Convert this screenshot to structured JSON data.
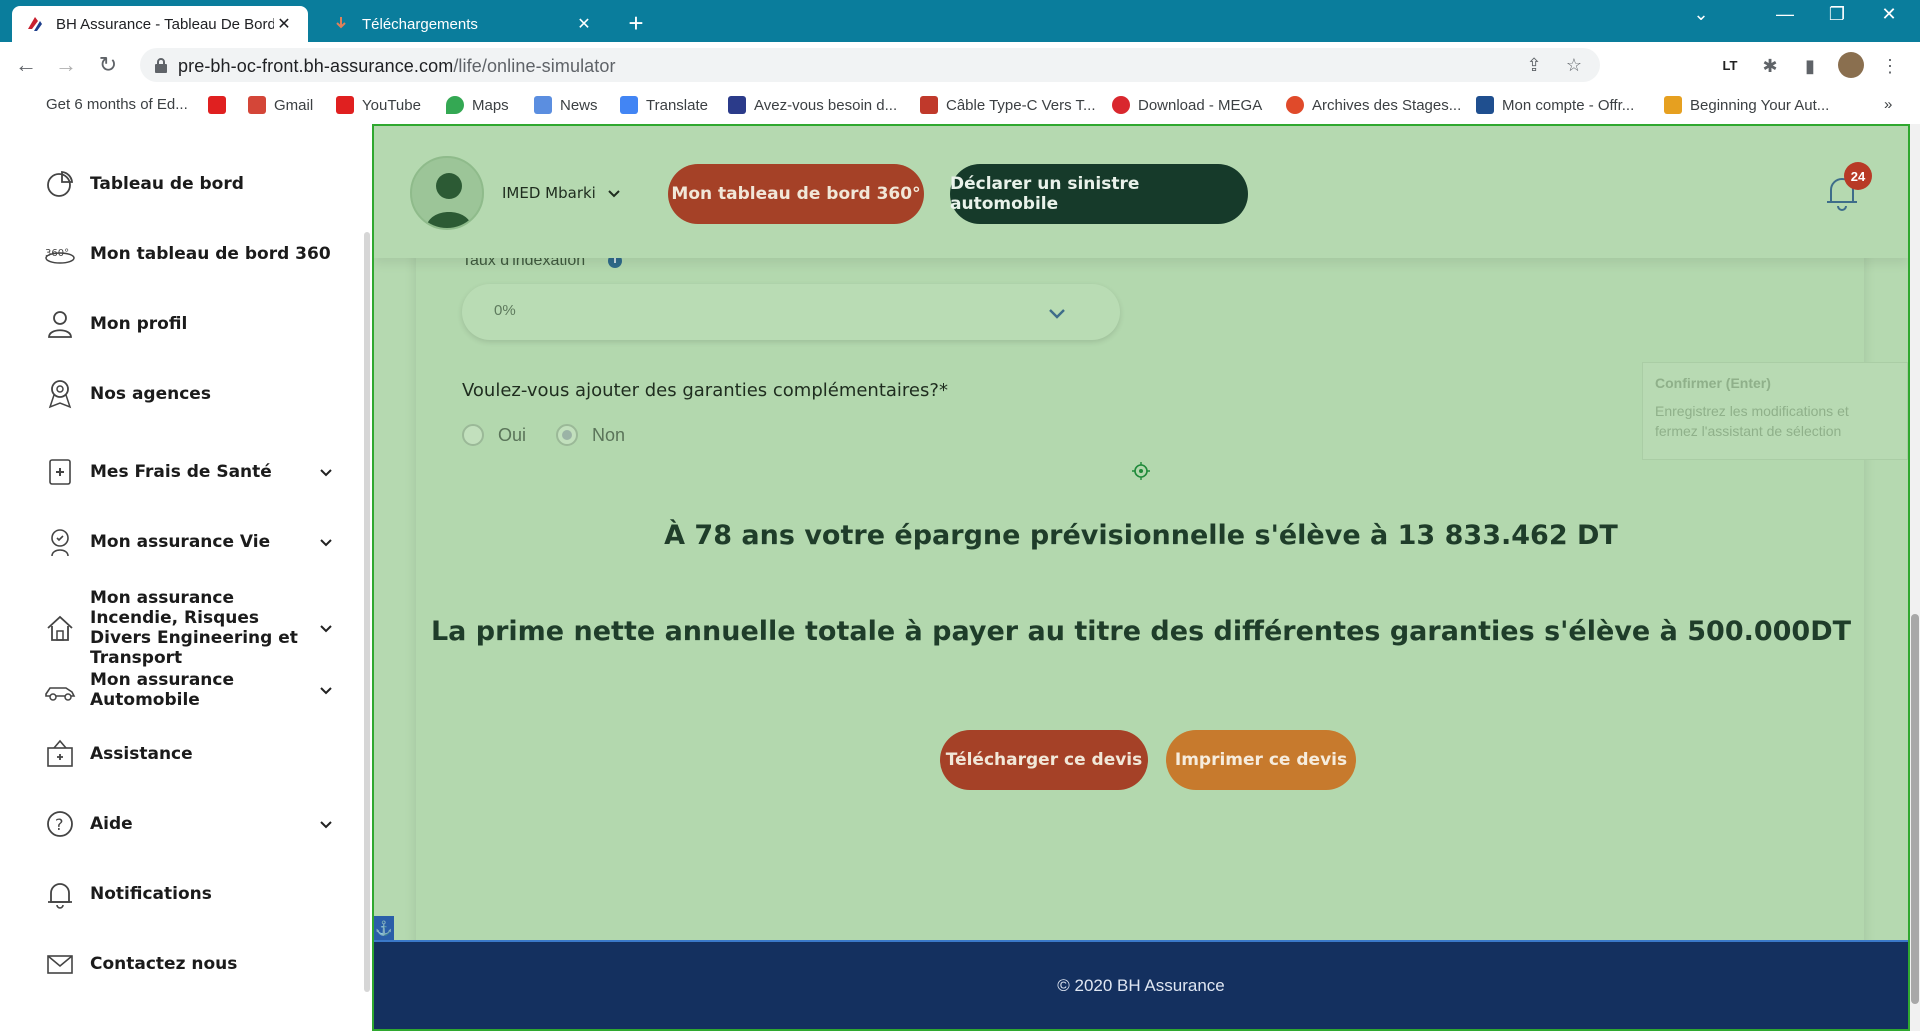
{
  "browser": {
    "tabs": [
      {
        "label": "BH Assurance - Tableau De Bord",
        "active": true,
        "close": "✕"
      },
      {
        "label": "Téléchargements",
        "active": false,
        "close": "✕"
      }
    ],
    "new_tab": "+",
    "window_controls": [
      "⌄",
      "—",
      "❐",
      "✕"
    ],
    "url_host": "pre-bh-oc-front.bh-assurance.com",
    "url_path": "/life/online-simulator",
    "bookmarks": [
      "Get 6 months of Ed...",
      "",
      "Gmail",
      "YouTube",
      "Maps",
      "News",
      "Translate",
      "Avez-vous besoin d...",
      "Câble Type-C Vers T...",
      "Download - MEGA",
      "Archives des Stages...",
      "Mon compte - Offr...",
      "Beginning Your Aut..."
    ],
    "bookmarks_more": "»",
    "extension_lt": "LT"
  },
  "sidebar": {
    "items": [
      {
        "label": "Tableau de bord",
        "icon": "chart-pie-icon",
        "chevron": false
      },
      {
        "label": "Mon tableau de bord 360",
        "icon": "360-icon",
        "chevron": false
      },
      {
        "label": "Mon profil",
        "icon": "user-icon",
        "chevron": false
      },
      {
        "label": "Nos agences",
        "icon": "map-pin-icon",
        "chevron": false
      },
      {
        "label": "Mes Frais de Santé",
        "icon": "health-icon",
        "chevron": true
      },
      {
        "label": "Mon assurance Vie",
        "icon": "life-icon",
        "chevron": true
      },
      {
        "label": "Mon assurance Incendie, Risques Divers Engineering et Transport",
        "icon": "house-icon",
        "chevron": true
      },
      {
        "label": "Mon assurance Automobile",
        "icon": "car-icon",
        "chevron": true
      },
      {
        "label": "Assistance",
        "icon": "assistance-icon",
        "chevron": false
      },
      {
        "label": "Aide",
        "icon": "help-icon",
        "chevron": true
      },
      {
        "label": "Notifications",
        "icon": "bell-icon",
        "chevron": false
      },
      {
        "label": "Contactez nous",
        "icon": "mail-icon",
        "chevron": false
      }
    ]
  },
  "header": {
    "username": "IMED Mbarki",
    "btn_360": "Mon tableau de bord 360°",
    "btn_sinistre": "Déclarer un sinistre automobile",
    "notification_count": "24"
  },
  "form": {
    "indexation_label": "Taux d'indexation",
    "indexation_value": "0%",
    "question": "Voulez-vous ajouter des garanties complémentaires?*",
    "option_yes": "Oui",
    "option_no": "Non",
    "selected": "Non"
  },
  "results": {
    "savings": "À 78 ans votre épargne prévisionnelle s'élève à 13 833.462 DT",
    "premium": "La prime nette annuelle totale à payer au titre des différentes garanties s'élève à 500.000DT"
  },
  "actions": {
    "download": "Télécharger ce devis",
    "print": "Imprimer ce devis"
  },
  "tooltip": {
    "title": "Confirmer (Enter)",
    "body": "Enregistrez les modifications et fermez l'assistant de sélection"
  },
  "footer": {
    "copyright": "© 2020 BH Assurance"
  },
  "colors": {
    "main_bg": "#b5d9b0",
    "primary_red": "#a54127",
    "dark_green": "#163a2a",
    "orange": "#c77a2d",
    "footer_navy": "#14305f",
    "tab_bar": "#0a7d9c"
  }
}
